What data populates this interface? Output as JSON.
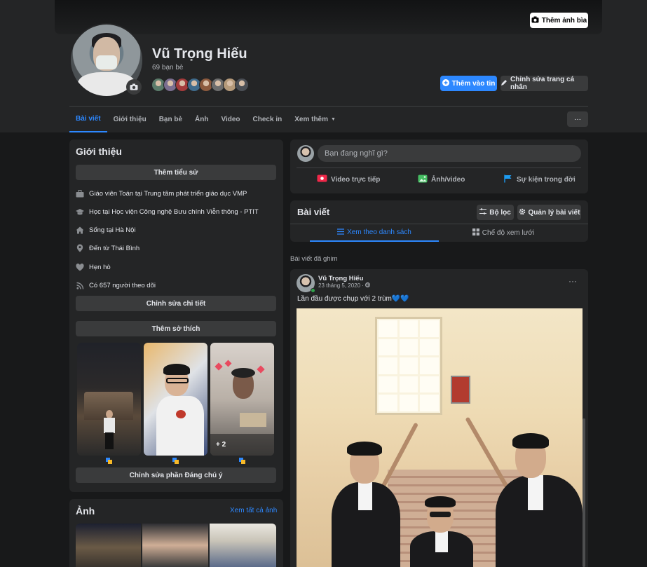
{
  "header": {
    "cover_button": "Thêm ảnh bìa",
    "name": "Vũ Trọng Hiếu",
    "friends_count": "69 bạn bè",
    "add_story": "Thêm vào tin",
    "edit_profile": "Chỉnh sửa trang cá nhân",
    "more_button": "···",
    "friend_avatar_colors": [
      "#5b7b6a",
      "#7a6e8f",
      "#a33b3b",
      "#3f6b8c",
      "#8c5a3e",
      "#6d6d6d",
      "#b59a7a",
      "#4b4f55"
    ]
  },
  "tabs": [
    "Bài viết",
    "Giới thiệu",
    "Bạn bè",
    "Ảnh",
    "Video",
    "Check in",
    "Xem thêm"
  ],
  "intro": {
    "title": "Giới thiệu",
    "add_bio": "Thêm tiểu sử",
    "items": [
      {
        "icon": "briefcase-icon",
        "text": "Giáo viên Toán tại Trung tâm phát triển giáo dục VMP"
      },
      {
        "icon": "graduation-cap-icon",
        "text": "Học tại Học viện Công nghệ Bưu chính Viễn thông - PTIT"
      },
      {
        "icon": "home-icon",
        "text": "Sống tại Hà Nội"
      },
      {
        "icon": "location-pin-icon",
        "text": "Đến từ Thái Bình"
      },
      {
        "icon": "heart-icon",
        "text": "Hẹn hò"
      },
      {
        "icon": "rss-icon",
        "text": "Có 657 người theo dõi"
      }
    ],
    "edit_details": "Chỉnh sửa chi tiết",
    "add_hobbies": "Thêm sở thích",
    "highlight_more": "+ 2",
    "edit_featured": "Chỉnh sửa phần Đáng chú ý"
  },
  "photos": {
    "title": "Ảnh",
    "see_all": "Xem tất cả ảnh"
  },
  "composer": {
    "placeholder": "Bạn đang nghĩ gì?",
    "live": "Video trực tiếp",
    "photo": "Ảnh/video",
    "life_event": "Sự kiện trong đời"
  },
  "posts": {
    "title": "Bài viết",
    "filter": "Bộ lọc",
    "manage": "Quản lý bài viết",
    "list_view": "Xem theo danh sách",
    "grid_view": "Chế độ xem lưới",
    "pinned_label": "Bài viết đã ghim"
  },
  "post": {
    "author": "Vũ Trọng Hiếu",
    "date": "23 tháng 5, 2020 · ",
    "text": "Lần đầu được chụp với 2 trùm💙💙",
    "more": "···"
  },
  "colors": {
    "accent": "#2d88ff",
    "background": "#18191a",
    "card": "#242526",
    "button": "#3a3b3c"
  }
}
